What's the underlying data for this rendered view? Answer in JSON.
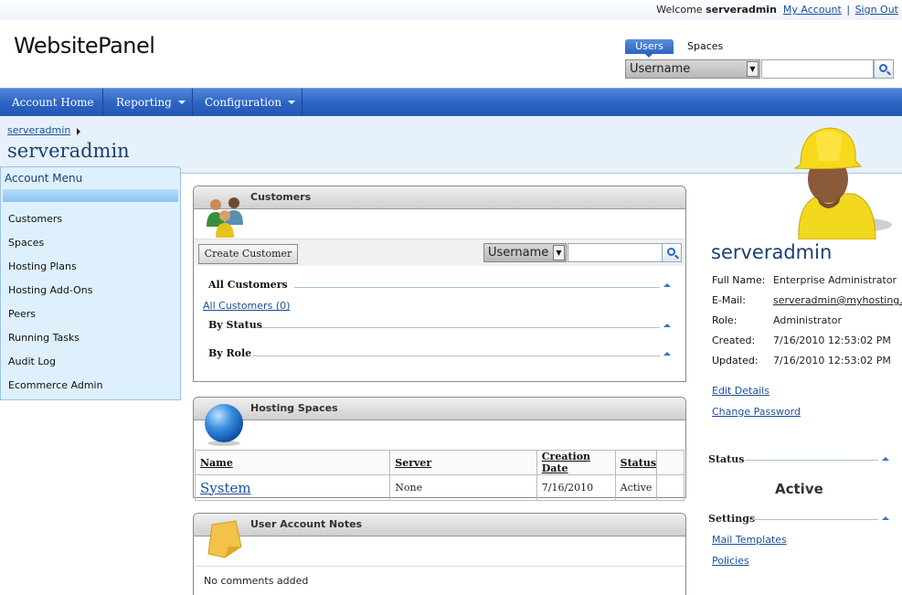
{
  "header": {
    "welcome_prefix": "Welcome",
    "username": "serveradmin",
    "my_account": "My Account",
    "separator": "|",
    "sign_out": "Sign Out",
    "logo": "WebsitePanel"
  },
  "search": {
    "tab_users": "Users",
    "tab_spaces": "Spaces",
    "field": "Username",
    "value": ""
  },
  "nav": {
    "items": [
      {
        "label": "Account Home"
      },
      {
        "label": "Reporting"
      },
      {
        "label": "Configuration"
      }
    ]
  },
  "breadcrumb": {
    "item": "serveradmin"
  },
  "page_title": "serveradmin",
  "account_menu": {
    "title": "Account Menu",
    "items": [
      "Customers",
      "Spaces",
      "Hosting Plans",
      "Hosting Add-Ons",
      "Peers",
      "Running Tasks",
      "Audit Log",
      "Ecommerce Admin"
    ]
  },
  "customers": {
    "title": "Customers",
    "create_button": "Create Customer",
    "search_field": "Username",
    "search_value": "",
    "all_customers_heading": "All Customers",
    "all_customers_link": "All Customers (0)",
    "by_status": "By Status",
    "by_role": "By Role"
  },
  "hosting_spaces": {
    "title": "Hosting Spaces",
    "columns": [
      "Name",
      "Server",
      "Creation Date",
      "Status"
    ],
    "rows": [
      {
        "name": "System",
        "server": "None",
        "date": "7/16/2010",
        "status": "Active"
      }
    ]
  },
  "notes": {
    "title": "User Account Notes",
    "empty": "No comments added"
  },
  "profile": {
    "name": "serveradmin",
    "full_name_label": "Full Name:",
    "full_name": "Enterprise Administrator",
    "email_label": "E-Mail:",
    "email": "serveradmin@myhosting.c",
    "role_label": "Role:",
    "role": "Administrator",
    "created_label": "Created:",
    "created": "7/16/2010 12:53:02 PM",
    "updated_label": "Updated:",
    "updated": "7/16/2010 12:53:02 PM",
    "edit_details": "Edit Details",
    "change_password": "Change Password",
    "status_heading": "Status",
    "status": "Active",
    "settings_heading": "Settings",
    "mail_templates": "Mail Templates",
    "policies": "Policies"
  },
  "colors": {
    "nav": "#2c62c2",
    "accent": "#1b4f9c",
    "menu_bg": "#def0fc"
  }
}
